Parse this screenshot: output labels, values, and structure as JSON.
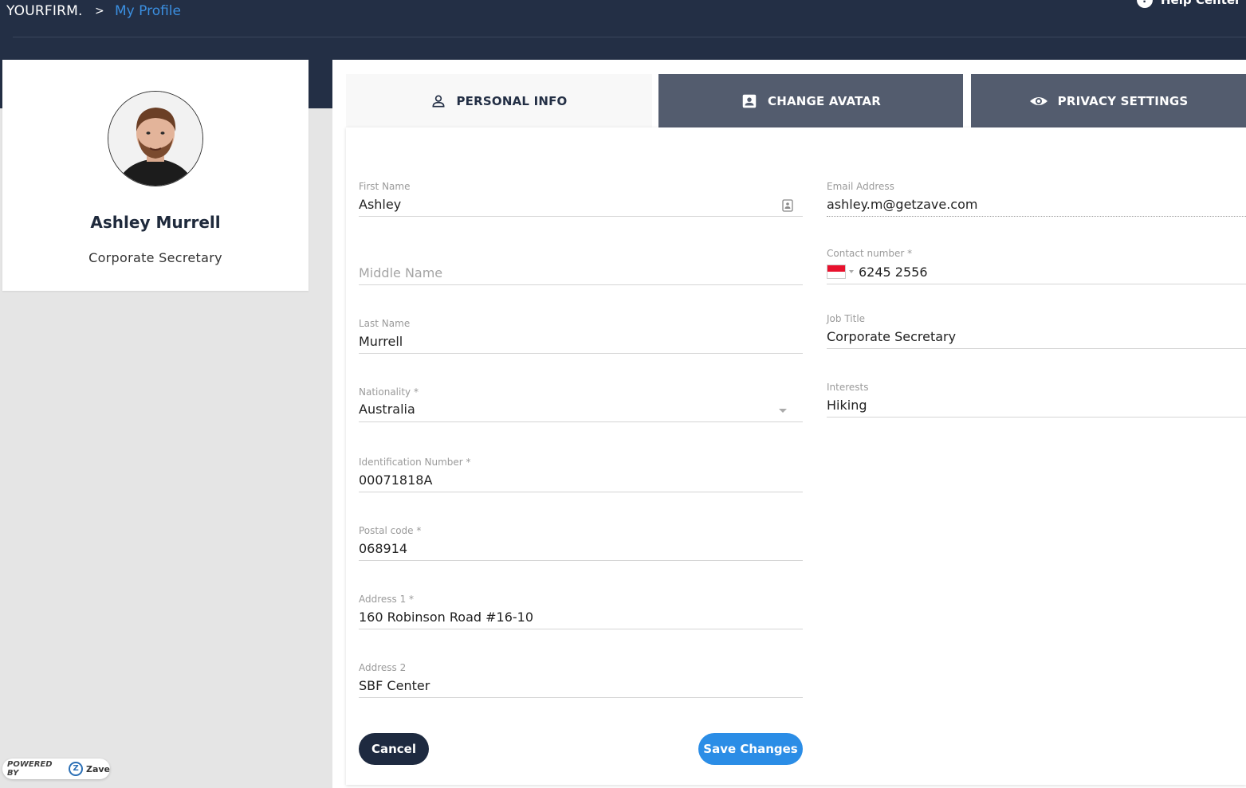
{
  "header": {
    "brand": "YOURFIRM.",
    "separator": ">",
    "current_page": "My Profile",
    "help_label": "Help Center"
  },
  "profile": {
    "name": "Ashley Murrell",
    "role": "Corporate Secretary"
  },
  "tabs": [
    {
      "label": "PERSONAL INFO",
      "icon": "person-icon",
      "active": true
    },
    {
      "label": "CHANGE AVATAR",
      "icon": "contact-card-icon",
      "active": false
    },
    {
      "label": "PRIVACY SETTINGS",
      "icon": "eye-icon",
      "active": false
    }
  ],
  "form": {
    "first_name": {
      "label": "First Name",
      "value": "Ashley"
    },
    "middle_name": {
      "label": "",
      "value": "",
      "placeholder": "Middle Name"
    },
    "last_name": {
      "label": "Last Name",
      "value": "Murrell"
    },
    "nationality": {
      "label": "Nationality *",
      "value": "Australia"
    },
    "id_number": {
      "label": "Identification Number *",
      "value": "00071818A"
    },
    "postal_code": {
      "label": "Postal code *",
      "value": "068914"
    },
    "address1": {
      "label": "Address 1 *",
      "value": "160 Robinson Road #16-10"
    },
    "address2": {
      "label": "Address 2",
      "value": "SBF Center"
    },
    "email": {
      "label": "Email Address",
      "value": "ashley.m@getzave.com"
    },
    "contact": {
      "label": "Contact number *",
      "value": "6245 2556",
      "country_flag": "singapore-flag-icon"
    },
    "job_title": {
      "label": "Job Title",
      "value": "Corporate Secretary"
    },
    "interests": {
      "label": "Interests",
      "value": "Hiking"
    }
  },
  "actions": {
    "cancel_label": "Cancel",
    "save_label": "Save Changes"
  },
  "footer": {
    "powered_by": "POWERED BY",
    "brand": "Zave"
  },
  "colors": {
    "header_bg": "#232f45",
    "accent_blue": "#2b8de6",
    "dark_button": "#1e2a40",
    "tab_inactive": "#535c6e"
  }
}
